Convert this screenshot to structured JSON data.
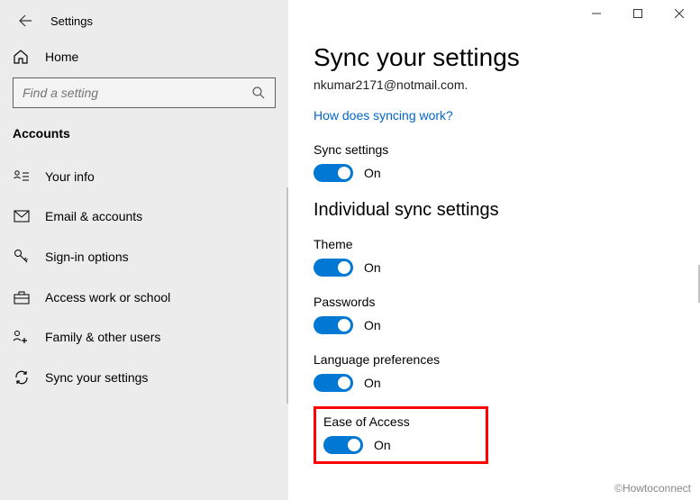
{
  "window": {
    "title": "Settings"
  },
  "sidebar": {
    "home_label": "Home",
    "search_placeholder": "Find a setting",
    "category": "Accounts",
    "items": [
      {
        "label": "Your info"
      },
      {
        "label": "Email & accounts"
      },
      {
        "label": "Sign-in options"
      },
      {
        "label": "Access work or school"
      },
      {
        "label": "Family & other users"
      },
      {
        "label": "Sync your settings"
      }
    ]
  },
  "page": {
    "title": "Sync your settings",
    "email_line": "nkumar2171@notmail.com.",
    "link": "How does syncing work?",
    "sync_label": "Sync settings",
    "toggle_on": "On",
    "section_title": "Individual sync settings",
    "toggles": {
      "theme": {
        "label": "Theme",
        "state": "On"
      },
      "passwords": {
        "label": "Passwords",
        "state": "On"
      },
      "lang": {
        "label": "Language preferences",
        "state": "On"
      },
      "ease": {
        "label": "Ease of Access",
        "state": "On"
      }
    }
  },
  "watermark": "©Howtoconnect"
}
